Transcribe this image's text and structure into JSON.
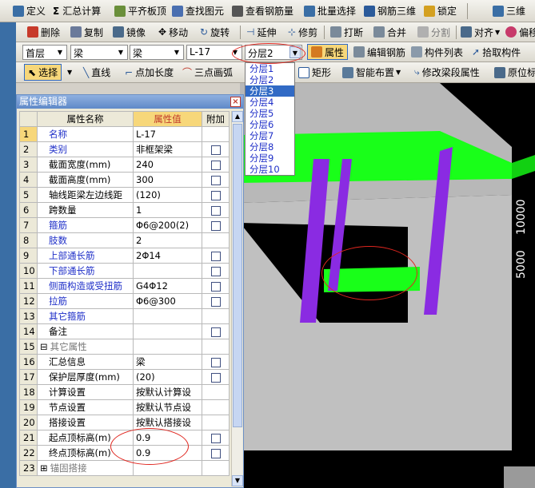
{
  "colors": {
    "toolbar_bg": "#dcd9cf",
    "sel_blue": "#316ac5",
    "highlight": "#f7d77a",
    "beam_green": "#19ff19",
    "stirrup_purple": "#8a2be2",
    "annot_red": "#e0261f"
  },
  "toolbar1": {
    "items": [
      {
        "label": "定义",
        "icon": "define-icon"
      },
      {
        "label": "汇总计算",
        "icon": "sigma-icon"
      },
      {
        "label": "平齐板顶",
        "icon": "align-icon"
      },
      {
        "label": "查找图元",
        "icon": "find-icon"
      },
      {
        "label": "查看钢筋量",
        "icon": "view-rebar-icon"
      },
      {
        "label": "批量选择",
        "icon": "batch-select-icon"
      },
      {
        "label": "钢筋三维",
        "icon": "rebar-3d-icon"
      },
      {
        "label": "锁定",
        "icon": "lock-icon"
      },
      {
        "label": "三维",
        "icon": "3d-icon"
      }
    ]
  },
  "toolbar2": {
    "items": [
      {
        "label": "删除",
        "icon": "delete-icon"
      },
      {
        "label": "复制",
        "icon": "copy-icon"
      },
      {
        "label": "镜像",
        "icon": "mirror-icon"
      },
      {
        "label": "移动",
        "icon": "move-icon"
      },
      {
        "label": "旋转",
        "icon": "rotate-icon"
      },
      {
        "label": "延伸",
        "icon": "extend-icon"
      },
      {
        "label": "修剪",
        "icon": "trim-icon"
      },
      {
        "label": "打断",
        "icon": "break-icon"
      },
      {
        "label": "合并",
        "icon": "merge-icon"
      },
      {
        "label": "分割",
        "icon": "split-icon"
      },
      {
        "label": "对齐",
        "icon": "align-icon"
      },
      {
        "label": "偏移",
        "icon": "offset-icon"
      }
    ]
  },
  "toolbar3": {
    "floor": "首层",
    "type1": "梁",
    "type2": "梁",
    "element": "L-17",
    "layer": "分层2",
    "buttons": [
      {
        "label": "属性",
        "icon": "property-icon"
      },
      {
        "label": "编辑钢筋",
        "icon": "edit-rebar-icon"
      },
      {
        "label": "构件列表",
        "icon": "list-icon"
      },
      {
        "label": "拾取构件",
        "icon": "pick-icon"
      }
    ]
  },
  "toolbar4": {
    "items": [
      {
        "label": "选择",
        "icon": "cursor-icon"
      },
      {
        "label": "直线",
        "icon": "line-icon"
      },
      {
        "label": "点加长度",
        "icon": "point-length-icon"
      },
      {
        "label": "三点画弧",
        "icon": "arc-icon"
      },
      {
        "label": "矩形",
        "icon": "rect-icon"
      },
      {
        "label": "智能布置",
        "icon": "smart-layout-icon"
      },
      {
        "label": "修改梁段属性",
        "icon": "edit-beam-icon"
      },
      {
        "label": "原位标",
        "icon": "inplace-icon"
      }
    ]
  },
  "layer_dropdown": [
    "分层1",
    "分层2",
    "分层3",
    "分层4",
    "分层5",
    "分层6",
    "分层7",
    "分层8",
    "分层9",
    "分层10"
  ],
  "layer_selected_index": 2,
  "prop_editor": {
    "title": "属性编辑器",
    "headers": {
      "name": "属性名称",
      "value": "属性值",
      "extra": "附加"
    },
    "rows": [
      {
        "num": "1",
        "name": "名称",
        "value": "L-17",
        "blue": true,
        "check": false
      },
      {
        "num": "2",
        "name": "类别",
        "value": "非框架梁",
        "blue": true,
        "check": true
      },
      {
        "num": "3",
        "name": "截面宽度(mm)",
        "value": "240",
        "blue": false,
        "check": true
      },
      {
        "num": "4",
        "name": "截面高度(mm)",
        "value": "300",
        "blue": false,
        "check": true
      },
      {
        "num": "5",
        "name": "轴线距梁左边线距",
        "value": "(120)",
        "blue": false,
        "check": true
      },
      {
        "num": "6",
        "name": "跨数量",
        "value": "1",
        "blue": false,
        "check": true
      },
      {
        "num": "7",
        "name": "箍筋",
        "value": "Φ6@200(2)",
        "blue": true,
        "check": true
      },
      {
        "num": "8",
        "name": "肢数",
        "value": "2",
        "blue": true,
        "check": false
      },
      {
        "num": "9",
        "name": "上部通长筋",
        "value": "2Φ14",
        "blue": true,
        "check": true
      },
      {
        "num": "10",
        "name": "下部通长筋",
        "value": "",
        "blue": true,
        "check": true
      },
      {
        "num": "11",
        "name": "侧面构造或受扭筋",
        "value": "G4Φ12",
        "blue": true,
        "check": true
      },
      {
        "num": "12",
        "name": "拉筋",
        "value": "Φ6@300",
        "blue": true,
        "check": true
      },
      {
        "num": "13",
        "name": "其它箍筋",
        "value": "",
        "blue": true,
        "check": false
      },
      {
        "num": "14",
        "name": "备注",
        "value": "",
        "blue": false,
        "check": true
      },
      {
        "num": "15",
        "name": "其它属性",
        "value": "",
        "blue": false,
        "check": false,
        "group": true
      },
      {
        "num": "16",
        "name": "汇总信息",
        "value": "梁",
        "blue": false,
        "check": true,
        "indent": true
      },
      {
        "num": "17",
        "name": "保护层厚度(mm)",
        "value": "(20)",
        "blue": false,
        "check": true,
        "indent": true
      },
      {
        "num": "18",
        "name": "计算设置",
        "value": "按默认计算设",
        "blue": false,
        "check": false,
        "indent": true
      },
      {
        "num": "19",
        "name": "节点设置",
        "value": "按默认节点设",
        "blue": false,
        "check": false,
        "indent": true
      },
      {
        "num": "20",
        "name": "搭接设置",
        "value": "按默认搭接设",
        "blue": false,
        "check": false,
        "indent": true
      },
      {
        "num": "21",
        "name": "起点顶标高(m)",
        "value": "0.9",
        "blue": false,
        "check": true,
        "indent": true
      },
      {
        "num": "22",
        "name": "终点顶标高(m)",
        "value": "0.9",
        "blue": false,
        "check": true,
        "indent": true
      },
      {
        "num": "23",
        "name": "锚固搭接",
        "value": "",
        "blue": false,
        "check": false,
        "group": true,
        "expand": "+"
      }
    ]
  },
  "dimensions": {
    "dim1": "10000",
    "dim2": "5000"
  }
}
